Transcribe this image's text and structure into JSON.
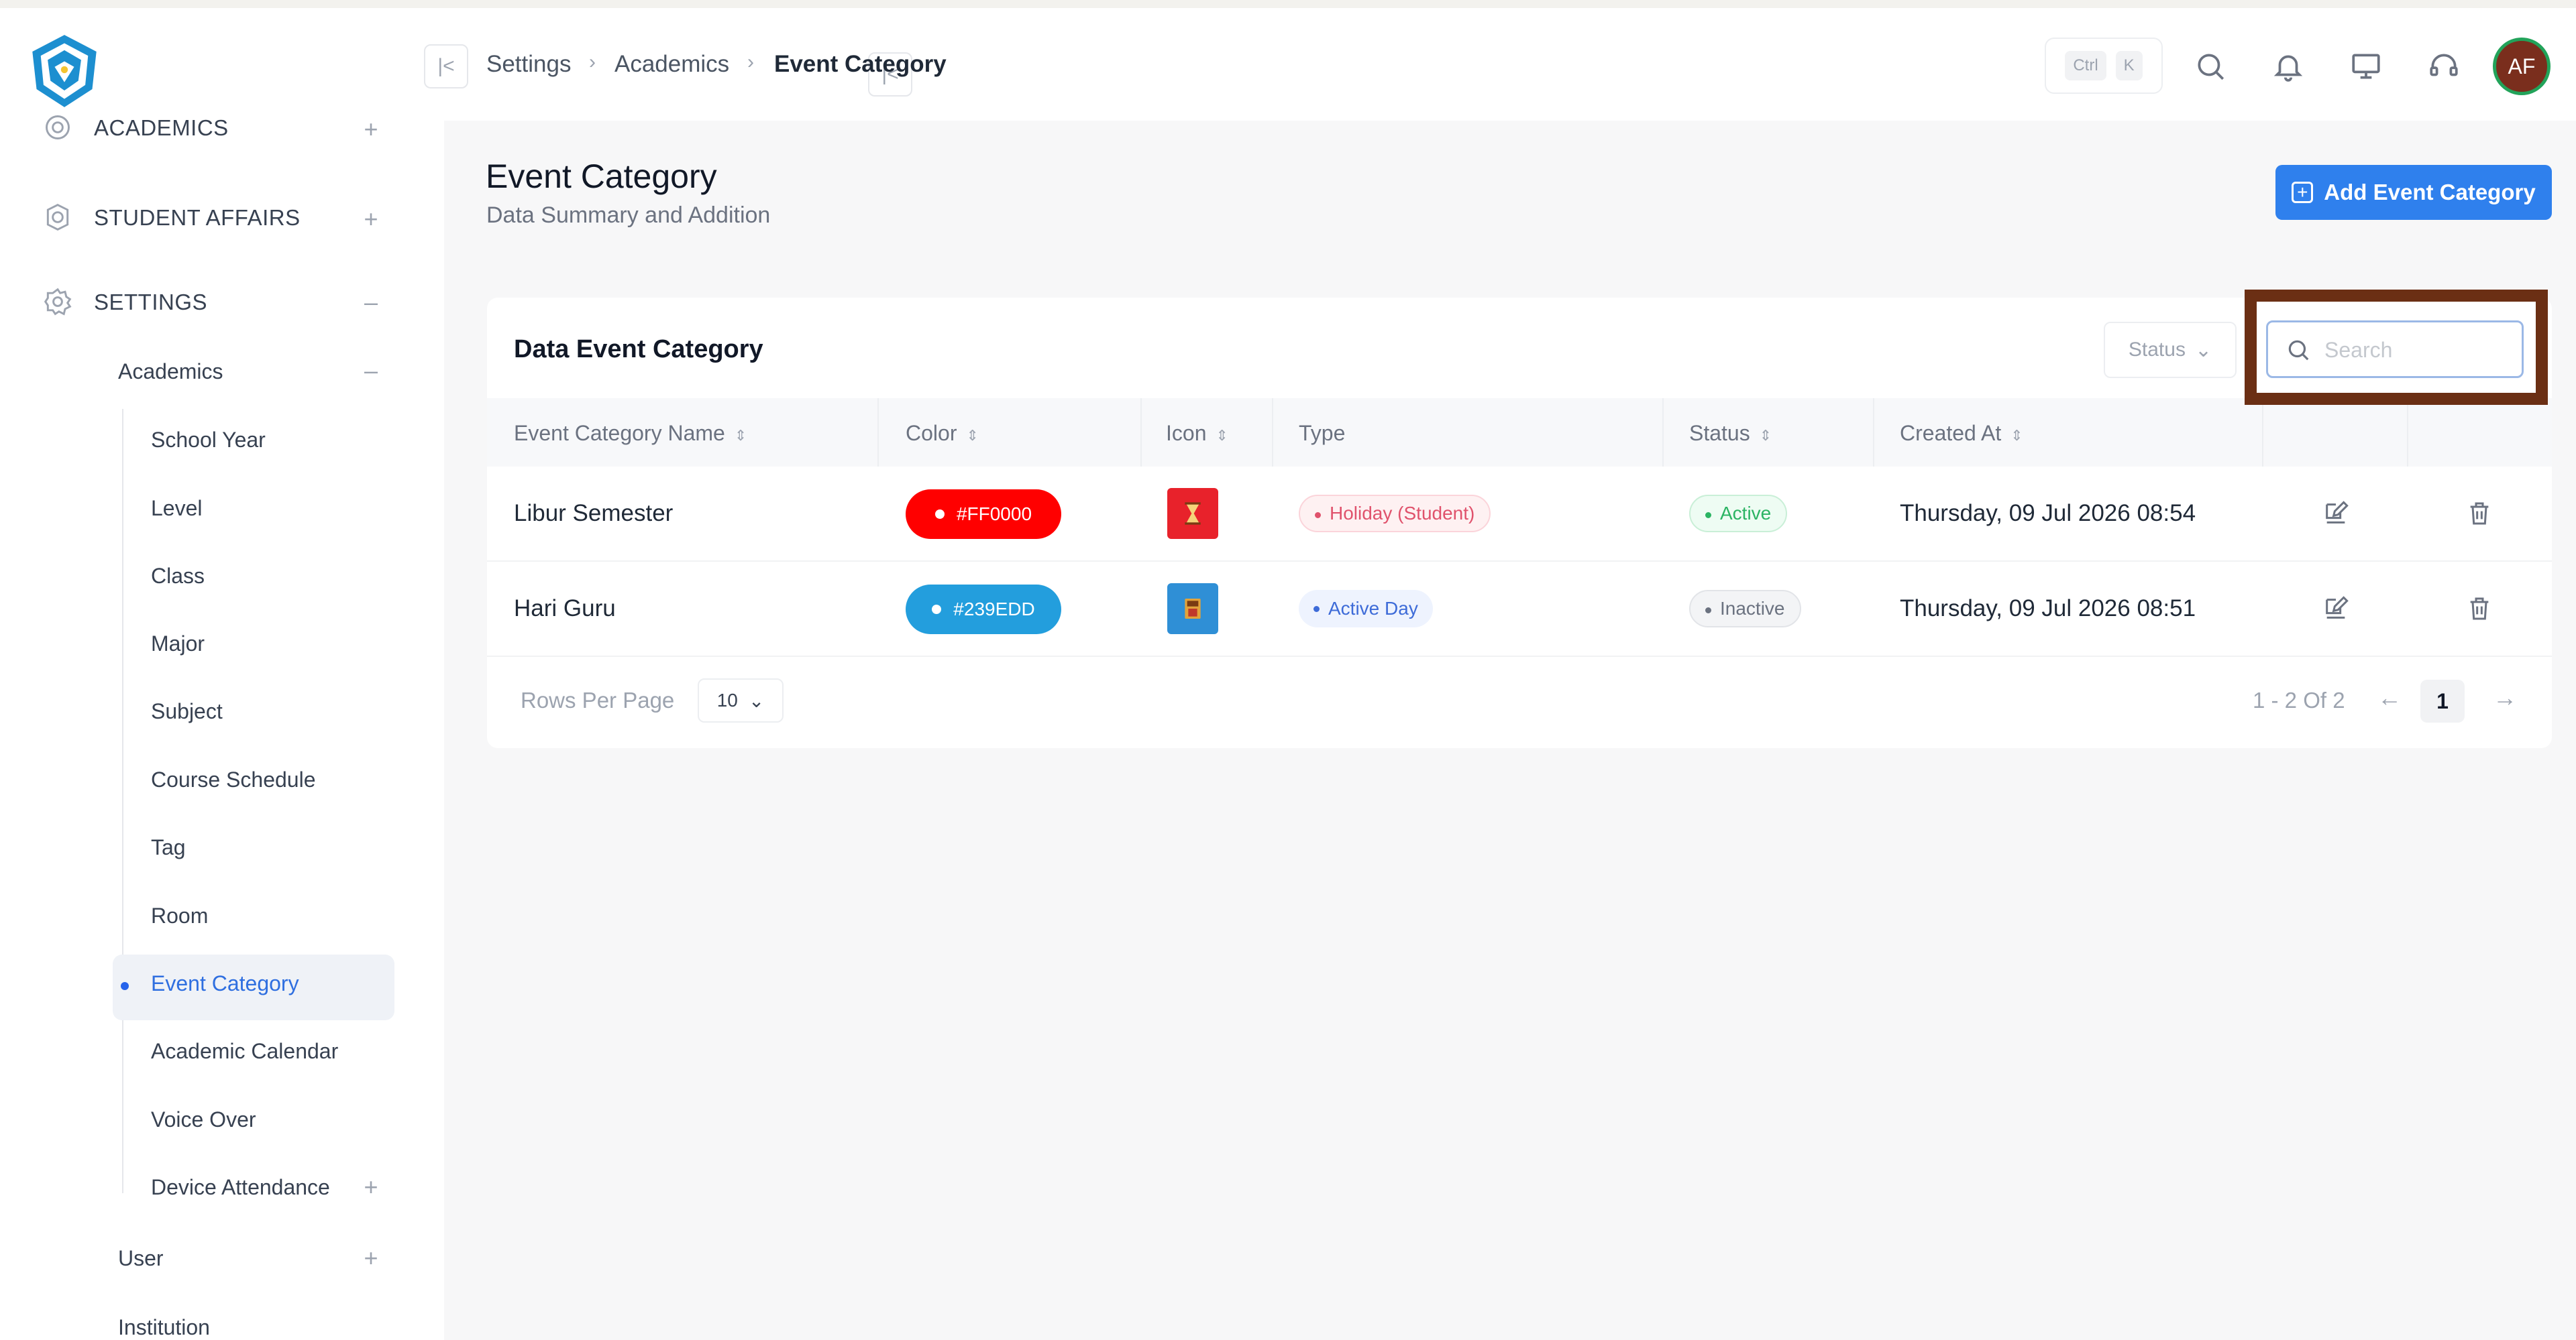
{
  "sidebar": {
    "top_items": [
      {
        "label": "ACADEMICS",
        "icon": "academics-icon"
      },
      {
        "label": "STUDENT AFFAIRS",
        "icon": "badge-icon"
      },
      {
        "label": "SETTINGS",
        "icon": "gear-icon"
      }
    ],
    "academics_label": "Academics",
    "academics_items": [
      "School Year",
      "Level",
      "Class",
      "Major",
      "Subject",
      "Course Schedule",
      "Tag",
      "Room",
      "Event Category",
      "Academic Calendar",
      "Voice Over",
      "Device Attendance"
    ],
    "user_label": "User",
    "institution_label": "Institution"
  },
  "topbar": {
    "breadcrumb": [
      "Settings",
      "Academics",
      "Event Category"
    ],
    "kbd_ctrl": "Ctrl",
    "kbd_k": "K",
    "avatar_initials": "AF"
  },
  "page": {
    "title": "Event Category",
    "subtitle": "Data Summary and Addition",
    "add_button": "Add Event Category"
  },
  "card": {
    "title": "Data Event Category",
    "status_filter": "Status",
    "search_placeholder": "Search",
    "columns": [
      "Event Category Name",
      "Color",
      "Icon",
      "Type",
      "Status",
      "Created At"
    ],
    "rows": [
      {
        "name": "Libur Semester",
        "color_hex": "#FF0000",
        "color_label": "#FF0000",
        "icon_bg": "#e8222b",
        "type": "Holiday (Student)",
        "status": "Active",
        "created_at": "Thursday, 09 Jul 2026 08:54"
      },
      {
        "name": "Hari Guru",
        "color_hex": "#239EDD",
        "color_label": "#239EDD",
        "icon_bg": "#2f8fd6",
        "type": "Active Day",
        "status": "Inactive",
        "created_at": "Thursday, 09 Jul 2026 08:51"
      }
    ],
    "rows_per_page_label": "Rows Per Page",
    "rows_per_page_value": "10",
    "pagination_info": "1 - 2 Of 2",
    "current_page": "1"
  }
}
